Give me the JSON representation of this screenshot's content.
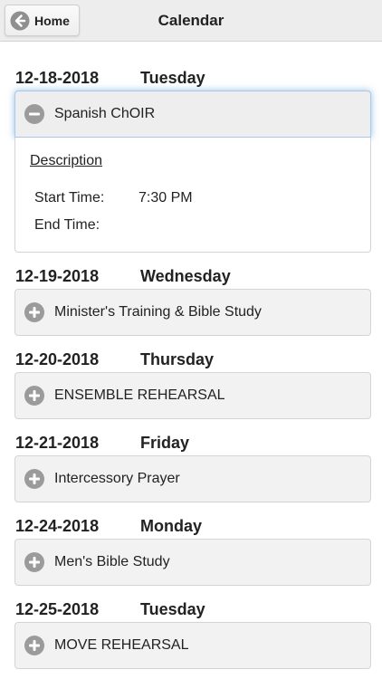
{
  "header": {
    "home_label": "Home",
    "title": "Calendar"
  },
  "events": [
    {
      "date": "12-18-2018",
      "weekday": "Tuesday",
      "title": "Spanish ChOIR",
      "expanded": true,
      "details": {
        "description_label": "Description",
        "start_label": "Start Time:",
        "start_value": "7:30 PM",
        "end_label": "End Time:",
        "end_value": ""
      }
    },
    {
      "date": "12-19-2018",
      "weekday": "Wednesday",
      "title": "Minister's Training & Bible Study",
      "expanded": false
    },
    {
      "date": "12-20-2018",
      "weekday": "Thursday",
      "title": "ENSEMBLE REHEARSAL",
      "expanded": false
    },
    {
      "date": "12-21-2018",
      "weekday": "Friday",
      "title": "Intercessory Prayer",
      "expanded": false
    },
    {
      "date": "12-24-2018",
      "weekday": "Monday",
      "title": "Men's Bible Study",
      "expanded": false
    },
    {
      "date": "12-25-2018",
      "weekday": "Tuesday",
      "title": "MOVE REHEARSAL",
      "expanded": false
    }
  ],
  "icons": {
    "home": "arrow-left-circle-icon",
    "expand": "plus-circle-icon",
    "collapse": "minus-circle-icon"
  },
  "colors": {
    "icon_gray": "#9b9b9b",
    "focus_glow": "#3887d2"
  }
}
